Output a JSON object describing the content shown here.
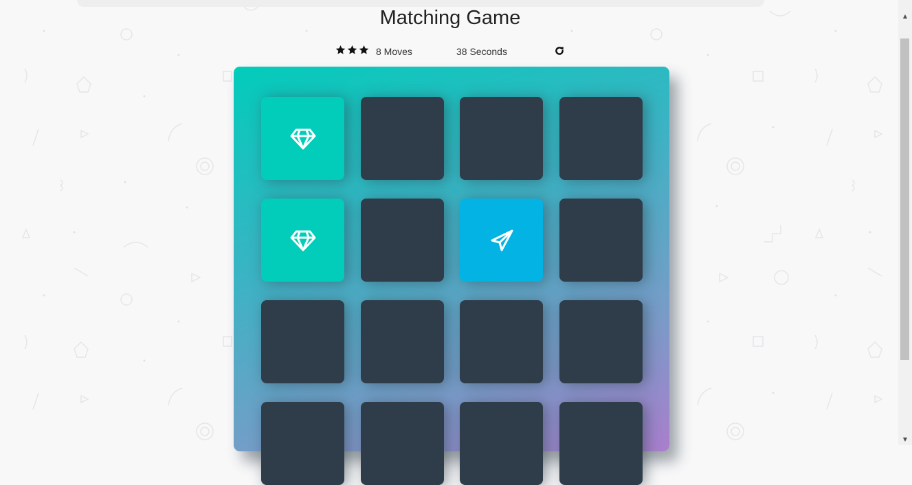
{
  "title": "Matching Game",
  "score_panel": {
    "stars_count": 3,
    "moves_text": "8 Moves",
    "timer_text": "38 Seconds",
    "restart_icon": "repeat-icon"
  },
  "deck": {
    "rows": 4,
    "columns": 4,
    "cards": [
      {
        "state": "match",
        "icon": "diamond-icon"
      },
      {
        "state": "closed",
        "icon": ""
      },
      {
        "state": "closed",
        "icon": ""
      },
      {
        "state": "closed",
        "icon": ""
      },
      {
        "state": "match",
        "icon": "diamond-icon"
      },
      {
        "state": "closed",
        "icon": ""
      },
      {
        "state": "open",
        "icon": "paper-plane-icon"
      },
      {
        "state": "closed",
        "icon": ""
      },
      {
        "state": "closed",
        "icon": ""
      },
      {
        "state": "closed",
        "icon": ""
      },
      {
        "state": "closed",
        "icon": ""
      },
      {
        "state": "closed",
        "icon": ""
      },
      {
        "state": "closed",
        "icon": ""
      },
      {
        "state": "closed",
        "icon": ""
      },
      {
        "state": "closed",
        "icon": ""
      },
      {
        "state": "closed",
        "icon": ""
      }
    ]
  },
  "colors": {
    "card_closed": "#2e3d49",
    "card_match": "#02ccba",
    "card_open": "#02b3e4",
    "deck_gradient_start": "#02ccba",
    "deck_gradient_end": "#aa7ecd"
  }
}
